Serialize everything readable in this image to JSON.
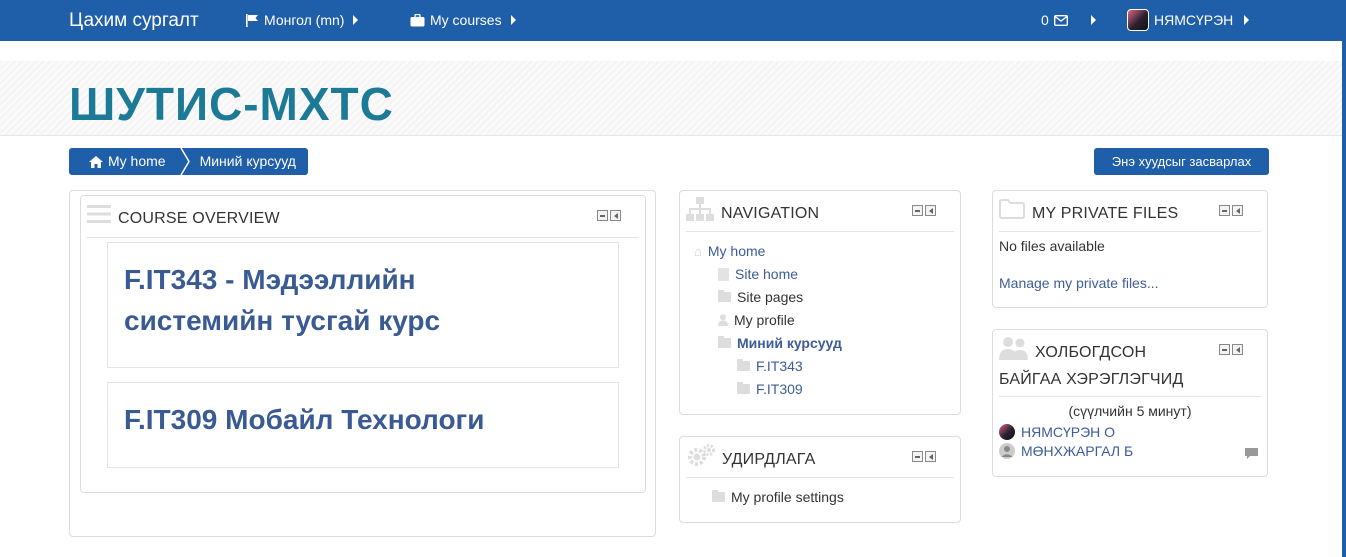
{
  "navbar": {
    "brand": "Цахим сургалт",
    "language": "Монгол (mn)",
    "my_courses": "My courses",
    "messages_count": "0",
    "user_name": "НЯМСҮРЭН"
  },
  "header": {
    "site_title": "ШУТИС-МХТС"
  },
  "breadcrumb": {
    "home": "My home",
    "current": "Миний курсууд"
  },
  "edit_button": "Энэ хуудсыг засварлах",
  "course_overview": {
    "title": "COURSE OVERVIEW",
    "courses": [
      {
        "name_line1": "F.IT343 - Мэдээллийн",
        "name_line2": "системийн тусгай курс"
      },
      {
        "name_line1": "F.IT309 Мобайл Технологи"
      }
    ]
  },
  "navigation": {
    "title": "NAVIGATION",
    "items": [
      {
        "label": "My home"
      },
      {
        "label": "Site home"
      },
      {
        "label": "Site pages"
      },
      {
        "label": "My profile"
      },
      {
        "label": "Миний курсууд"
      },
      {
        "label": "F.IT343"
      },
      {
        "label": "F.IT309"
      }
    ]
  },
  "admin": {
    "title": "УДИРДЛАГА",
    "items": [
      {
        "label": "My profile settings"
      }
    ]
  },
  "private_files": {
    "title": "MY PRIVATE FILES",
    "empty": "No files available",
    "manage": "Manage my private files..."
  },
  "online_users": {
    "title_line1": "ХОЛБОГДСОН",
    "title_line2": "БАЙГАА ХЭРЭГЛЭГЧИД",
    "subtitle": "(сүүлчийн 5 минут)",
    "users": [
      {
        "name": "НЯМСҮРЭН О"
      },
      {
        "name": "МӨНХЖАРГАЛ Б"
      }
    ]
  }
}
